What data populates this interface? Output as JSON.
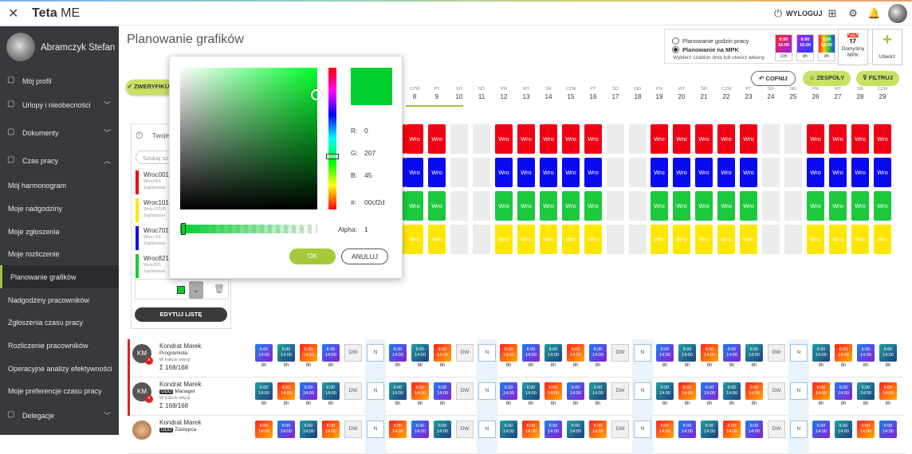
{
  "app": {
    "close_icon": "close-icon",
    "logo_bold": "Teta",
    "logo_rest": " ME",
    "logout": "WYLOGUJ"
  },
  "sidebar": {
    "user_name": "Abramczyk Stefan",
    "items": [
      {
        "label": "Mój profil",
        "icon": "user-icon"
      },
      {
        "label": "Urlopy i nieobecności",
        "icon": "plane-icon",
        "chevron": "down"
      },
      {
        "label": "Dokumenty",
        "icon": "folder-icon",
        "chevron": "down"
      },
      {
        "label": "Czas pracy",
        "icon": "clock-group-icon",
        "chevron": "up"
      },
      {
        "label": "Mój harmonogram"
      },
      {
        "label": "Moje nadgodziny"
      },
      {
        "label": "Moje zgłoszenia"
      },
      {
        "label": "Moje rozliczenie"
      },
      {
        "label": "Planowanie grafików",
        "active": true
      },
      {
        "label": "Nadgodziny pracowników"
      },
      {
        "label": "Zgłoszenia czasu pracy"
      },
      {
        "label": "Rozliczenie pracowników"
      },
      {
        "label": "Operacyjne analizy efektywności"
      },
      {
        "label": "Moje preferencje czasu pracy"
      },
      {
        "label": "Delegacje",
        "icon": "suitcase-icon",
        "chevron": "down"
      }
    ]
  },
  "page": {
    "title": "Planowanie grafików"
  },
  "settings": {
    "option1": "Planowanie godzin pracy",
    "option2": "Planowanie na MPK",
    "hint": "Wybierz szablon dnia lub utwórz własny",
    "templates": [
      {
        "top": "6:00\n16:00",
        "bottom": "10h",
        "color": "linear-gradient(135deg,#ff2020,#a020f0)"
      },
      {
        "top": "6:00\n16:00",
        "bottom": "8h",
        "color": "linear-gradient(135deg,#a020f0,#2040ff)"
      },
      {
        "top": "6:00\n16:00",
        "bottom": "8h",
        "color": "linear-gradient(90deg,#ff2020,#ffcc00,#20c040,#2040ff)"
      }
    ],
    "default_mpk": "Domyślny MPK",
    "create": "Utwórz"
  },
  "toolbar": {
    "verify": "ZWERYFIKUJ",
    "undo": "COFNIJ",
    "teams": "ZESPOŁY",
    "filter": "FILTRUJ"
  },
  "days": [
    {
      "name": "CZW",
      "num": "8"
    },
    {
      "name": "PT",
      "num": "9"
    },
    {
      "name": "SO",
      "num": "10"
    },
    {
      "name": "ND",
      "num": "11"
    },
    {
      "name": "PN",
      "num": "12"
    },
    {
      "name": "WT",
      "num": "13"
    },
    {
      "name": "ŚR",
      "num": "14"
    },
    {
      "name": "CZW",
      "num": "15"
    },
    {
      "name": "PT",
      "num": "16"
    },
    {
      "name": "SO",
      "num": "17"
    },
    {
      "name": "ND",
      "num": "18"
    },
    {
      "name": "PN",
      "num": "19"
    },
    {
      "name": "WT",
      "num": "20"
    },
    {
      "name": "ŚR",
      "num": "21"
    },
    {
      "name": "CZW",
      "num": "22"
    },
    {
      "name": "PT",
      "num": "23"
    },
    {
      "name": "SO",
      "num": "24"
    },
    {
      "name": "ND",
      "num": "25"
    },
    {
      "name": "PN",
      "num": "26"
    },
    {
      "name": "WT",
      "num": "27"
    },
    {
      "name": "ŚR",
      "num": "28"
    },
    {
      "name": "CZW",
      "num": "29"
    }
  ],
  "grid_label": "Wro",
  "panel": {
    "title": "Twoje",
    "search_placeholder": "Szukaj sz",
    "items": [
      {
        "name": "Wroc001",
        "code": "Wroc001",
        "status": "Zaplanowa",
        "color": "#f00014"
      },
      {
        "name": "Wroc101",
        "code": "Wroc10100",
        "status": "Zaplanowa",
        "color": "#ffe600"
      },
      {
        "name": "Wroc701",
        "code": "Wroc701",
        "status": "Zaplanowa",
        "color": "#0a0af0"
      },
      {
        "name": "Wroc821",
        "code": "Wroc821",
        "status": "Zaplanowa",
        "color": "#1cc83c"
      }
    ],
    "edit": "EDYTUJ LISTĘ"
  },
  "picker": {
    "r_label": "R:",
    "r": "0",
    "g_label": "G:",
    "g": "207",
    "b_label": "B:",
    "b": "45",
    "hex_label": "#:",
    "hex": "00cf2d",
    "alpha_label": "Alpha:",
    "alpha": "1",
    "ok": "OK",
    "cancel": "ANULUJ",
    "color": "#00cf2d"
  },
  "people": [
    {
      "initials": "KM",
      "name": "Kondrat Marek",
      "odd": "",
      "role": "Programista",
      "status": "W trakcie edycji",
      "sum": "Σ 168/168"
    },
    {
      "initials": "KM",
      "name": "Kondrat Marek",
      "odd": "ODD",
      "role": "Manager",
      "status": "W trakcie edycji",
      "sum": "Σ 168/168"
    },
    {
      "initials": "",
      "name": "Kondrat Marek",
      "odd": "ODD",
      "role": "Zastępca",
      "status": "",
      "sum": ""
    }
  ],
  "shift": {
    "time": "6:00\n14:00",
    "hours": "8h",
    "dw": "DW",
    "n": "N"
  }
}
